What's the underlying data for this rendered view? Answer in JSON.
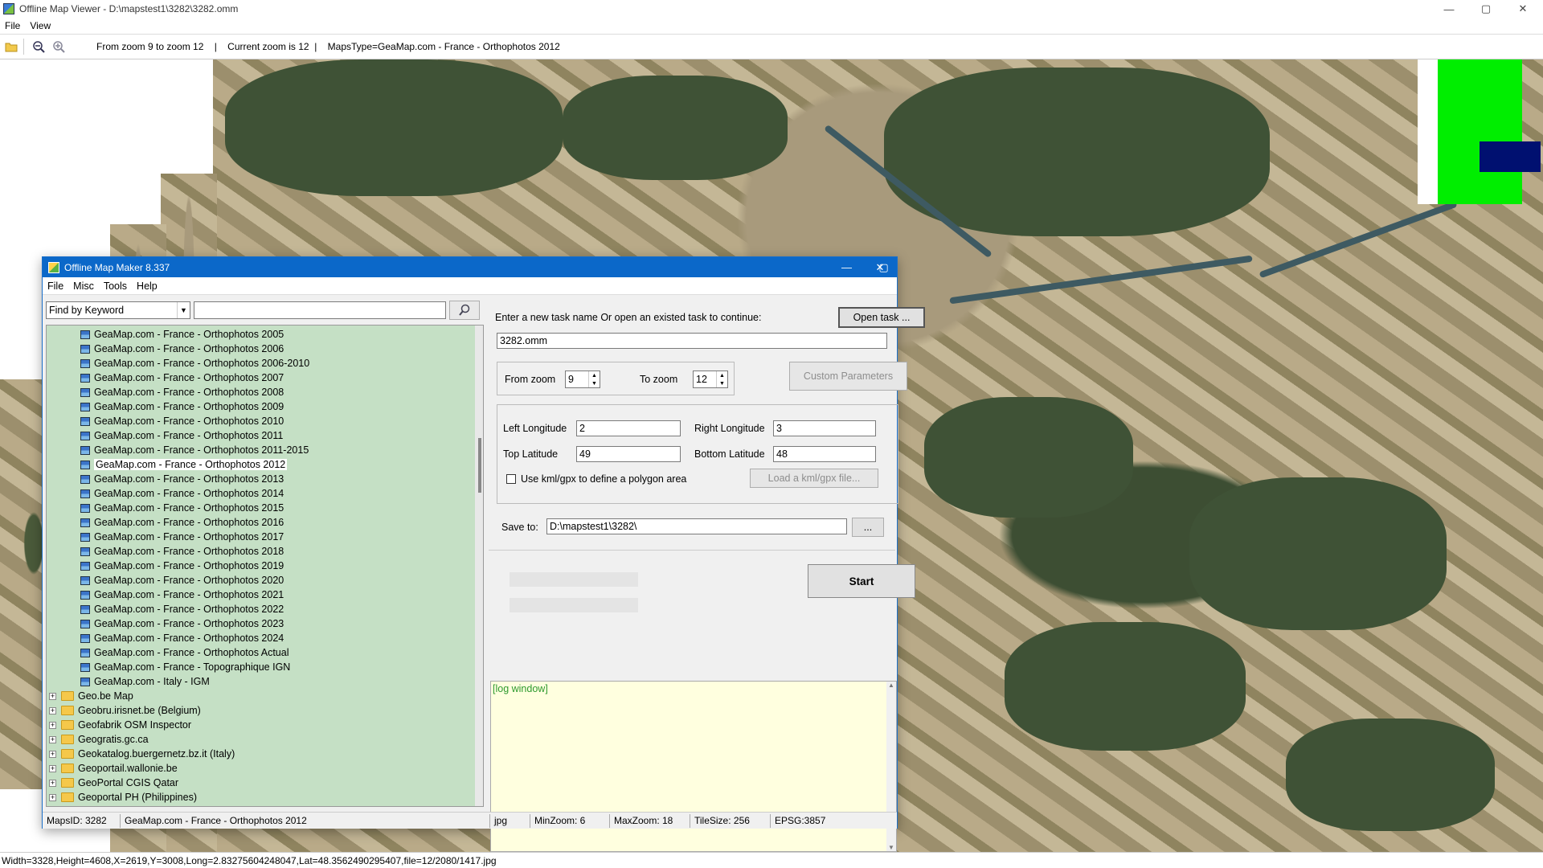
{
  "window": {
    "title": "Offline Map Viewer - D:\\mapstest1\\3282\\3282.omm",
    "controls": {
      "minimize": "—",
      "maximize": "▢",
      "close": "✕"
    }
  },
  "menu": [
    "File",
    "View"
  ],
  "toolbar": {
    "info": "From zoom 9 to zoom 12    |    Current zoom is 12  |    MapsType=GeaMap.com - France - Orthophotos 2012"
  },
  "statusbar": "Width=3328,Height=4608,X=2619,Y=3008,Long=2.83275604248047,Lat=48.3562490295407,file=12/2080/1417.jpg",
  "dialog": {
    "title": "Offline Map Maker 8.337",
    "menu": [
      "File",
      "Misc",
      "Tools",
      "Help"
    ],
    "search": {
      "mode": "Find by Keyword",
      "value": ""
    },
    "tree": {
      "maps": [
        "GeaMap.com - France - Orthophotos 2005",
        "GeaMap.com - France - Orthophotos 2006",
        "GeaMap.com - France - Orthophotos 2006-2010",
        "GeaMap.com - France - Orthophotos 2007",
        "GeaMap.com - France - Orthophotos 2008",
        "GeaMap.com - France - Orthophotos 2009",
        "GeaMap.com - France - Orthophotos 2010",
        "GeaMap.com - France - Orthophotos 2011",
        "GeaMap.com - France - Orthophotos 2011-2015",
        "GeaMap.com - France - Orthophotos 2012",
        "GeaMap.com - France - Orthophotos 2013",
        "GeaMap.com - France - Orthophotos 2014",
        "GeaMap.com - France - Orthophotos 2015",
        "GeaMap.com - France - Orthophotos 2016",
        "GeaMap.com - France - Orthophotos 2017",
        "GeaMap.com - France - Orthophotos 2018",
        "GeaMap.com - France - Orthophotos 2019",
        "GeaMap.com - France - Orthophotos 2020",
        "GeaMap.com - France - Orthophotos 2021",
        "GeaMap.com - France - Orthophotos 2022",
        "GeaMap.com - France - Orthophotos 2023",
        "GeaMap.com - France - Orthophotos 2024",
        "GeaMap.com - France - Orthophotos Actual",
        "GeaMap.com - France - Topographique IGN",
        "GeaMap.com - Italy - IGM"
      ],
      "selected_index": 9,
      "folders": [
        "Geo.be Map",
        "Geobru.irisnet.be (Belgium)",
        "Geofabrik OSM Inspector",
        "Geogratis.gc.ca",
        "Geokatalog.buergernetz.bz.it (Italy)",
        "Geoportail.wallonie.be",
        "GeoPortal CGIS Qatar",
        "Geoportal PH (Philippines)"
      ]
    },
    "task": {
      "prompt": "Enter a new task name Or open an existed task to continue:",
      "open_btn": "Open task ...",
      "name": "3282.omm"
    },
    "zoom": {
      "from_label": "From zoom",
      "from": "9",
      "to_label": "To zoom",
      "to": "12",
      "custom_btn": "Custom Parameters"
    },
    "area": {
      "left_lon_label": "Left Longitude",
      "left_lon": "2",
      "right_lon_label": "Right Longitude",
      "right_lon": "3",
      "top_lat_label": "Top Latitude",
      "top_lat": "49",
      "bottom_lat_label": "Bottom Latitude",
      "bottom_lat": "48",
      "kml_label": "Use kml/gpx to define a polygon area",
      "kml_btn": "Load a kml/gpx file..."
    },
    "save": {
      "label": "Save to:",
      "path": "D:\\mapstest1\\3282\\",
      "browse": "..."
    },
    "start_btn": "Start",
    "log": "[log window]",
    "status": {
      "mapsid": "MapsID: 3282",
      "mapname": "GeaMap.com - France - Orthophotos 2012",
      "format": "jpg",
      "minzoom": "MinZoom: 6",
      "maxzoom": "MaxZoom: 18",
      "tilesize": "TileSize: 256",
      "epsg": "EPSG:3857"
    }
  }
}
